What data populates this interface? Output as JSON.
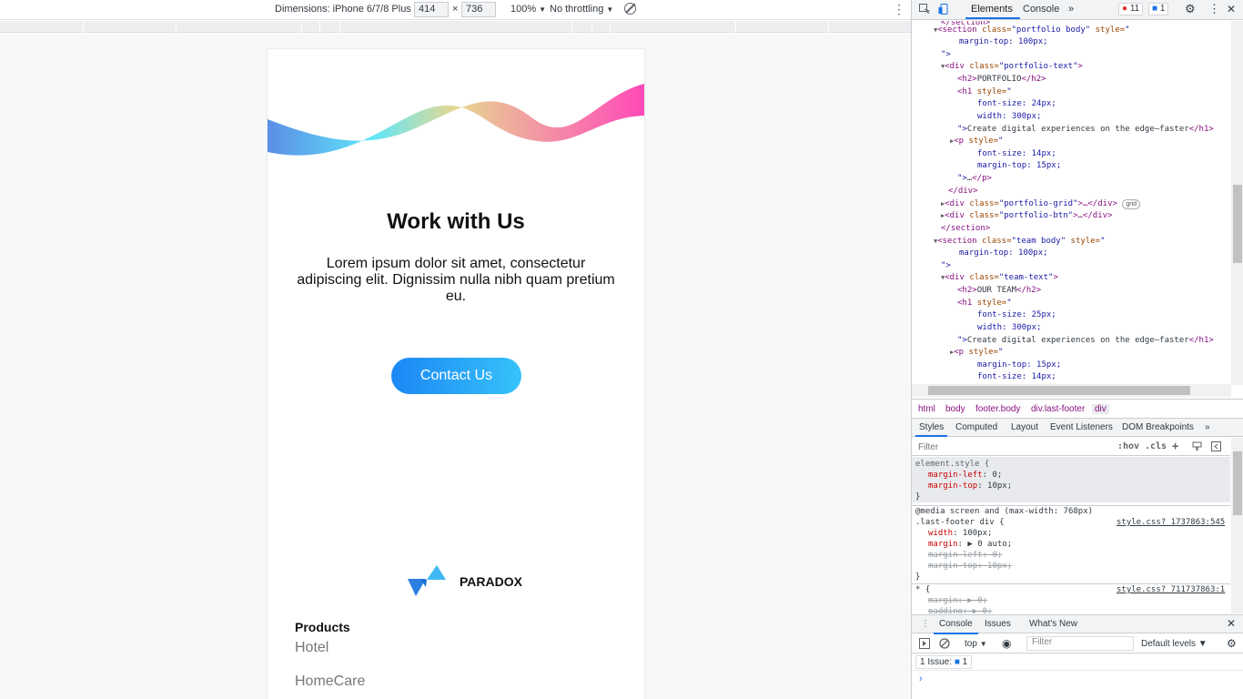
{
  "device_toolbar": {
    "dimensions_label": "Dimensions: iPhone 6/7/8 Plus",
    "width": "414",
    "height": "736",
    "times": "×",
    "zoom": "100%",
    "throttling": "No throttling",
    "caret": "▼",
    "more": "⋮"
  },
  "page": {
    "title": "Work with Us",
    "description": "Lorem ipsum dolor sit amet, consectetur adipiscing elit. Dignissim nulla nibh quam pretium eu.",
    "contact_button": "Contact Us",
    "brand_name": "PARADOX",
    "products_title": "Products",
    "products_items": [
      "Hotel",
      "HomeCare"
    ],
    "colors": {
      "button_start": "#1c87f5",
      "button_end": "#36c2fb",
      "logo": "#1e88e5"
    }
  },
  "devtools": {
    "tabs": {
      "elements": "Elements",
      "console": "Console",
      "more": "»"
    },
    "errors": "11",
    "messages": "1",
    "elements_lines": {
      "l0": {
        "open": "<section ",
        "attr1": "class=",
        "val1": "\"portfolio body\"",
        "attr2": " style=",
        "val2": "\""
      },
      "l1": "margin-top: 100px;",
      "l2": "\">",
      "l3": {
        "open": "<div ",
        "attr": "class=",
        "val": "\"portfolio-text\"",
        "close": ">"
      },
      "l4": {
        "open": "<h2>",
        "text": "PORTFOLIO",
        "close": "</h2>"
      },
      "l5": {
        "open": "<h1 ",
        "attr": "style=",
        "val": "\""
      },
      "l6": "font-size: 24px;",
      "l7": "width: 300px;",
      "l8": {
        "val": "\">",
        "text": "Create digital experiences on the edge—faster",
        "close": "</h1>"
      },
      "l9": {
        "open": "<p ",
        "attr": "style=",
        "val": "\""
      },
      "l10": "font-size: 14px;",
      "l11": "margin-top: 15px;",
      "l12": {
        "val": "\">",
        "text": "…",
        "close": "</p>"
      },
      "l13": "</div>",
      "l14": {
        "open": "<div ",
        "attr": "class=",
        "val": "\"portfolio-grid\"",
        "close": ">…</div>",
        "badge": "grid"
      },
      "l15": {
        "open": "<div ",
        "attr": "class=",
        "val": "\"portfolio-btn\"",
        "close": ">…</div>"
      },
      "l16": "</section>",
      "l17": {
        "open": "<section ",
        "attr1": "class=",
        "val1": "\"team body\"",
        "attr2": " style=",
        "val2": "\""
      },
      "l18": "margin-top: 100px;",
      "l19": "\">",
      "l20": {
        "open": "<div ",
        "attr": "class=",
        "val": "\"team-text\"",
        "close": ">"
      },
      "l21": {
        "open": "<h2>",
        "text": "OUR TEAM",
        "close": "</h2>"
      },
      "l22": {
        "open": "<h1 ",
        "attr": "style=",
        "val": "\""
      },
      "l23": "font-size: 25px;",
      "l24": "width: 300px;",
      "l25": {
        "val": "\">",
        "text": "Create digital experiences on the edge—faster",
        "close": "</h1>"
      },
      "l26": {
        "open": "<p ",
        "attr": "style=",
        "val": "\""
      },
      "l27": "margin-top: 15px;",
      "l28": "font-size: 14px;"
    },
    "breadcrumbs": [
      "html",
      "body",
      "footer.body",
      "div.last-footer",
      "div"
    ],
    "styles_tabs": [
      "Styles",
      "Computed",
      "Layout",
      "Event Listeners",
      "DOM Breakpoints",
      "»"
    ],
    "filter_placeholder": "Filter",
    "hov": ":hov",
    "cls": ".cls",
    "plus": "+",
    "styles": {
      "element_style": "element.style {",
      "ml_prop": "margin-left",
      "ml_val": ": 0;",
      "mt_prop": "margin-top",
      "mt_val": ": 10px;",
      "close": "}",
      "media": "@media screen and (max-width: 768px)",
      "rule_selector": ".last-footer div {",
      "rule_source": "style.css?_1737863:545",
      "w_prop": "width",
      "w_val": ": 100px;",
      "m_prop": "margin",
      "m_val": ": ▶ 0 auto;",
      "s1": "margin-left: 0;",
      "s2": "margin-top: 10px;",
      "star": "* {",
      "star_source": "style.css?_711737863:1",
      "s3": "margin: ▶ 0;",
      "s4": "padding: ▶ 0;"
    },
    "drawer_tabs": [
      "Console",
      "Issues",
      "What's New"
    ],
    "context": "top",
    "console_filter": "Filter",
    "levels": "Default levels ▼",
    "issues_label": "1 Issue:",
    "issues_count": "1",
    "prompt": "›",
    "close": "✕"
  }
}
